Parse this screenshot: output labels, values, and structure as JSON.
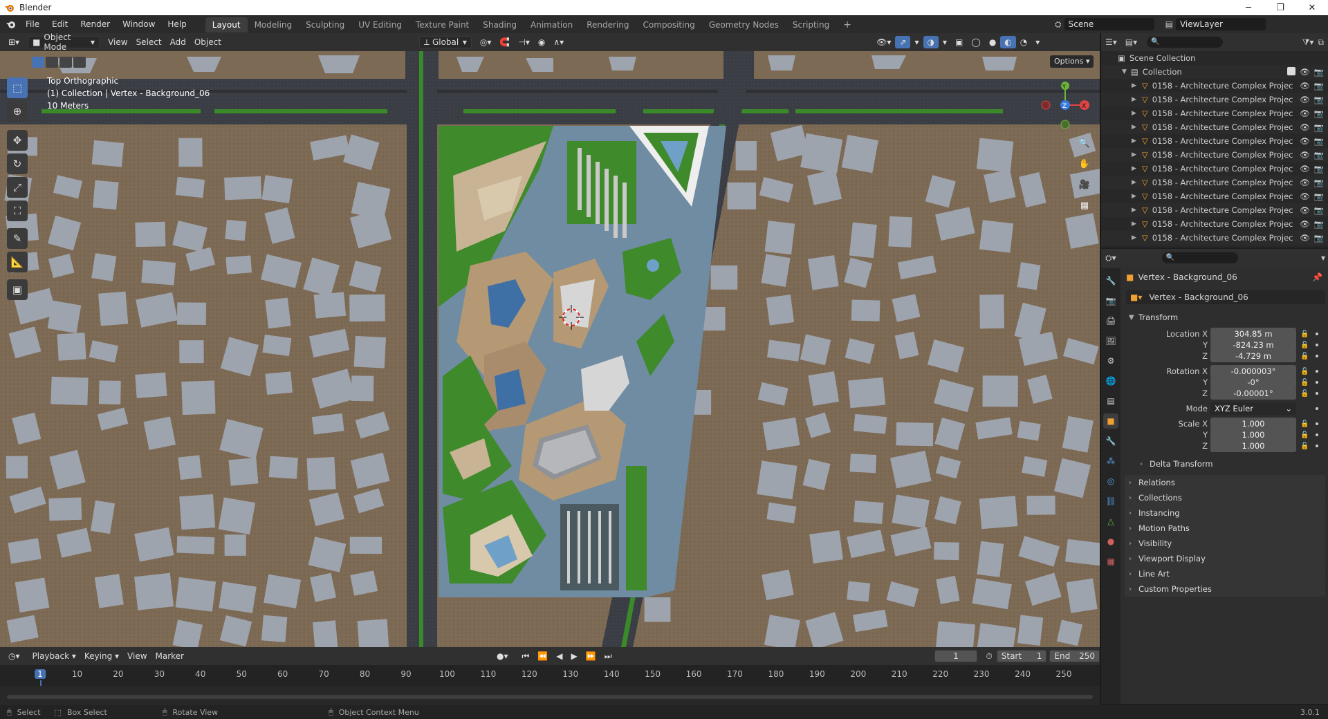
{
  "window": {
    "title": "Blender",
    "min": "─",
    "max": "❐",
    "close": "✕"
  },
  "menu": [
    "File",
    "Edit",
    "Render",
    "Window",
    "Help"
  ],
  "workspaces": [
    {
      "label": "Layout",
      "active": true
    },
    {
      "label": "Modeling"
    },
    {
      "label": "Sculpting"
    },
    {
      "label": "UV Editing"
    },
    {
      "label": "Texture Paint"
    },
    {
      "label": "Shading"
    },
    {
      "label": "Animation"
    },
    {
      "label": "Rendering"
    },
    {
      "label": "Compositing"
    },
    {
      "label": "Geometry Nodes"
    },
    {
      "label": "Scripting"
    }
  ],
  "add_workspace": "+",
  "scene": {
    "label": "Scene",
    "viewlayer": "ViewLayer"
  },
  "viewport_header": {
    "mode": "Object Mode",
    "menus": [
      "View",
      "Select",
      "Add",
      "Object"
    ],
    "orientation": "Global",
    "options": "Options"
  },
  "viewport_overlay": {
    "view_name": "Top Orthographic",
    "collection_info": "(1) Collection | Vertex - Background_06",
    "scale": "10 Meters"
  },
  "gizmo": {
    "x": "X",
    "y": "Y",
    "z": "Z"
  },
  "outliner": {
    "scene_collection": "Scene Collection",
    "collection": "Collection",
    "items": [
      "0158 - Architecture Complex Projec",
      "0158 - Architecture Complex Projec",
      "0158 - Architecture Complex Projec",
      "0158 - Architecture Complex Projec",
      "0158 - Architecture Complex Projec",
      "0158 - Architecture Complex Projec",
      "0158 - Architecture Complex Projec",
      "0158 - Architecture Complex Projec",
      "0158 - Architecture Complex Projec",
      "0158 - Architecture Complex Projec",
      "0158 - Architecture Complex Projec",
      "0158 - Architecture Complex Projec"
    ]
  },
  "properties": {
    "object_name": "Vertex - Background_06",
    "datablock": "Vertex - Background_06",
    "transform_title": "Transform",
    "location": {
      "label_x": "Location X",
      "x": "304.85 m",
      "y": "-824.23 m",
      "z": "-4.729 m"
    },
    "rotation": {
      "label_x": "Rotation X",
      "x": "-0.000003°",
      "y": "-0°",
      "z": "-0.00001°"
    },
    "mode": {
      "label": "Mode",
      "value": "XYZ Euler"
    },
    "scale": {
      "label_x": "Scale X",
      "x": "1.000",
      "y": "1.000",
      "z": "1.000"
    },
    "axis_y": "Y",
    "axis_z": "Z",
    "delta": "Delta Transform",
    "panels": [
      "Relations",
      "Collections",
      "Instancing",
      "Motion Paths",
      "Visibility",
      "Viewport Display",
      "Line Art",
      "Custom Properties"
    ]
  },
  "timeline": {
    "menus": [
      "Playback",
      "Keying",
      "View",
      "Marker"
    ],
    "current_frame": "1",
    "start_label": "Start",
    "start": "1",
    "end_label": "End",
    "end": "250",
    "ticks": [
      "1",
      "10",
      "20",
      "30",
      "40",
      "50",
      "60",
      "70",
      "80",
      "90",
      "100",
      "110",
      "120",
      "130",
      "140",
      "150",
      "160",
      "170",
      "180",
      "190",
      "200",
      "210",
      "220",
      "230",
      "240",
      "250"
    ]
  },
  "status": {
    "select": "Select",
    "box_select": "Box Select",
    "rotate_view": "Rotate View",
    "context_menu": "Object Context Menu",
    "version": "3.0.1"
  },
  "colors": {
    "accent": "#4772b3",
    "ground": "#7d6a55",
    "building": "#9ea4ad",
    "water": "#6f8ca3",
    "grass": "#3f8a2a",
    "road": "#3a3d42"
  }
}
